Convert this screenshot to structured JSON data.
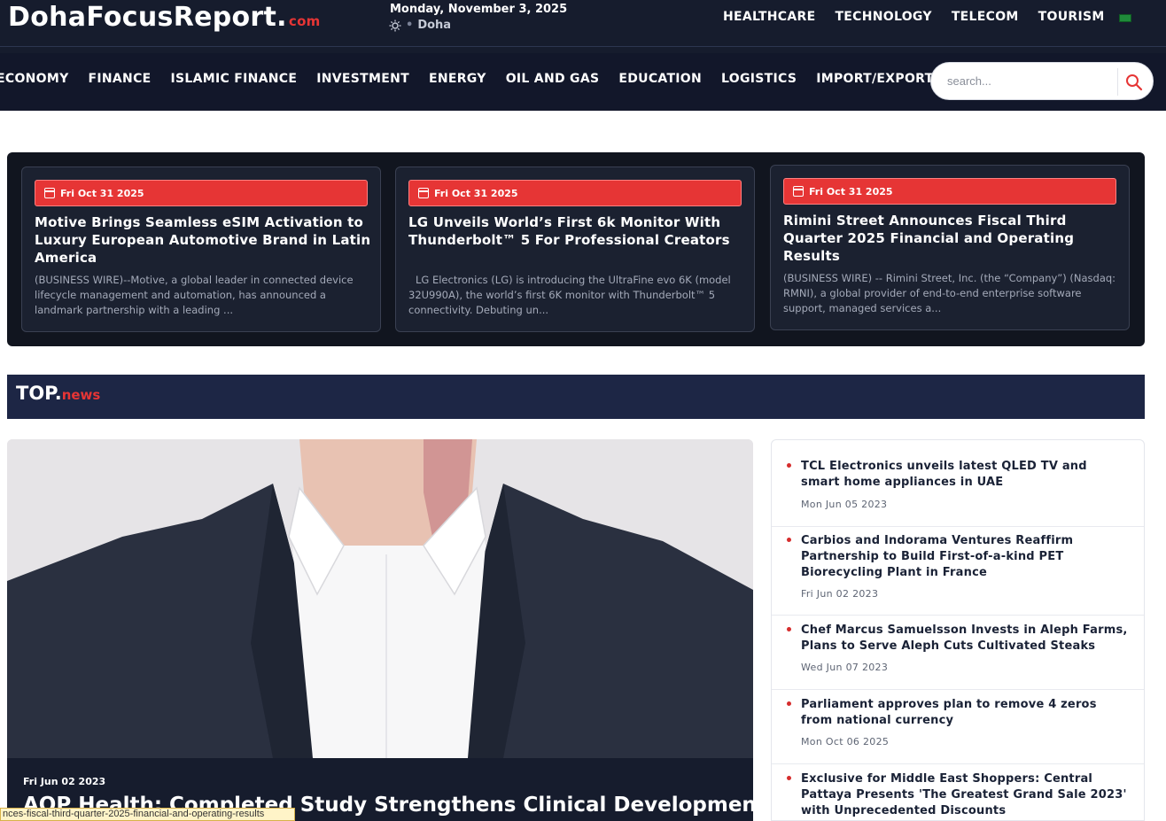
{
  "header": {
    "logo_main": "DohaFocusReport.",
    "logo_suffix": "com",
    "date": "Monday, November 3, 2025",
    "location": "Doha",
    "top_links": [
      "HEALTHCARE",
      "TECHNOLOGY",
      "TELECOM",
      "TOURISM"
    ]
  },
  "nav": {
    "items": [
      "ECONOMY",
      "FINANCE",
      "ISLAMIC FINANCE",
      "INVESTMENT",
      "ENERGY",
      "OIL AND GAS",
      "EDUCATION",
      "LOGISTICS",
      "IMPORT/EXPORT"
    ],
    "search_placeholder": "search..."
  },
  "featured": [
    {
      "date": "Fri Oct 31 2025",
      "title": "Motive Brings Seamless eSIM Activation to Luxury European Automotive Brand in Latin America",
      "excerpt": "(BUSINESS WIRE)--Motive, a global leader in connected device lifecycle management and automation, has announced a landmark partnership with a leading ..."
    },
    {
      "date": "Fri Oct 31 2025",
      "title": "LG Unveils World’s First 6k Monitor With Thunderbolt™ 5 For Professional Creators",
      "excerpt": "LG Electronics (LG) is introducing the UltraFine evo 6K (model 32U990A), the world’s first 6K monitor with Thunderbolt™ 5 connectivity. Debuting un..."
    },
    {
      "date": "Fri Oct 31 2025",
      "title": "Rimini Street Announces Fiscal Third Quarter 2025 Financial and Operating Results",
      "excerpt": "(BUSINESS WIRE) -- Rimini Street, Inc. (the “Company”) (Nasdaq: RMNI), a global provider of end-to-end enterprise software support, managed services a..."
    }
  ],
  "top_news": {
    "heading_main": "TOP.",
    "heading_suffix": "news",
    "hero_date": "Fri Jun 02 2023",
    "hero_title": "AOP Health: Completed Study Strengthens Clinical Development",
    "sidebar": [
      {
        "title": "TCL Electronics unveils latest QLED TV and smart home appliances in UAE",
        "date": "Mon Jun 05 2023"
      },
      {
        "title": "Carbios and Indorama Ventures Reaffirm Partnership to Build First-of-a-kind PET Biorecycling Plant in France",
        "date": "Fri Jun 02 2023"
      },
      {
        "title": "Chef Marcus Samuelsson Invests in Aleph Farms, Plans to Serve Aleph Cuts Cultivated Steaks",
        "date": "Wed Jun 07 2023"
      },
      {
        "title": "Parliament approves plan to remove 4 zeros from national currency",
        "date": "Mon Oct 06 2025"
      },
      {
        "title": "Exclusive for Middle East Shoppers: Central Pattaya Presents 'The Greatest Grand Sale 2023' with Unprecedented Discounts",
        "date": ""
      }
    ]
  },
  "status_bar": {
    "url": "nces-fiscal-third-quarter-2025-financial-and-operating-results"
  },
  "colors": {
    "header_bg": "#161c2d",
    "accent_red": "#e63535",
    "topnews_bar": "#1d2645"
  }
}
